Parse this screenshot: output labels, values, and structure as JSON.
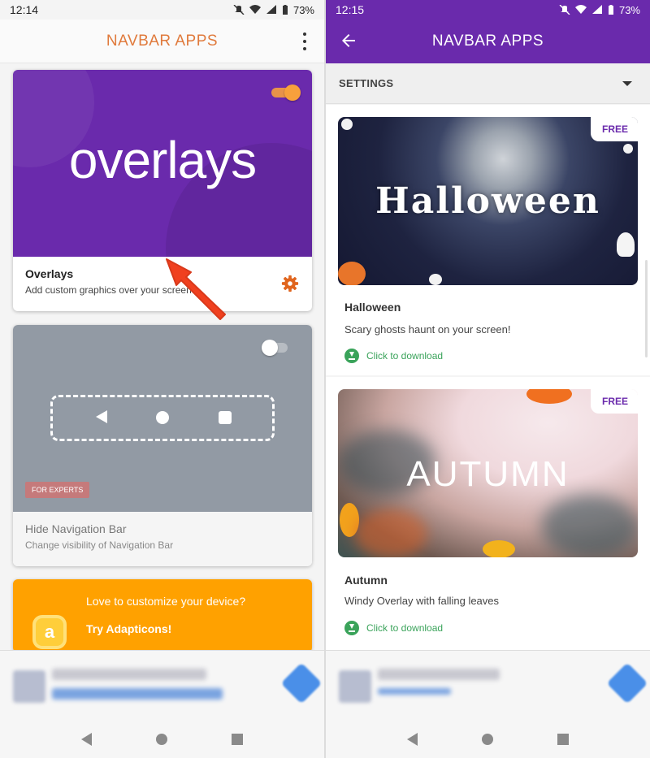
{
  "left": {
    "status": {
      "time": "12:14",
      "battery": "73%"
    },
    "appbar": {
      "title": "NAVBAR APPS"
    },
    "overlays_card": {
      "banner_word": "overlays",
      "title": "Overlays",
      "subtitle": "Add custom graphics over your screen",
      "toggle_on": true
    },
    "navbar_card": {
      "badge": "FOR EXPERTS",
      "title": "Hide Navigation Bar",
      "subtitle": "Change visibility of Navigation Bar",
      "toggle_on": false
    },
    "adapticons_card": {
      "icon_letter": "a",
      "line1": "Love to customize your device?",
      "line2": "Try Adapticons!"
    }
  },
  "right": {
    "status": {
      "time": "12:15",
      "battery": "73%"
    },
    "appbar": {
      "title": "NAVBAR APPS"
    },
    "settings": {
      "label": "SETTINGS"
    },
    "themes": [
      {
        "image_word": "Halloween",
        "tag": "FREE",
        "title": "Halloween",
        "description": "Scary ghosts haunt on your screen!",
        "download": "Click to download"
      },
      {
        "image_word": "AUTUMN",
        "tag": "FREE",
        "title": "Autumn",
        "description": "Windy Overlay with falling leaves",
        "download": "Click to download"
      }
    ]
  },
  "colors": {
    "purple": "#6a2aac",
    "orange_title": "#e07a3c",
    "toggle_orange": "#f7a03c",
    "gray_banner": "#929aa4",
    "adapticons_orange": "#ffa100",
    "download_green": "#3aa35a",
    "annotation_red": "#f0401f"
  },
  "icons": [
    "mute-icon",
    "wifi-icon",
    "signal-icon",
    "battery-icon",
    "more-vert-icon",
    "back-arrow-icon",
    "gear-icon",
    "dropdown-caret-icon",
    "download-icon",
    "nav-back-icon",
    "nav-home-icon",
    "nav-recents-icon",
    "red-arrow-annotation"
  ]
}
